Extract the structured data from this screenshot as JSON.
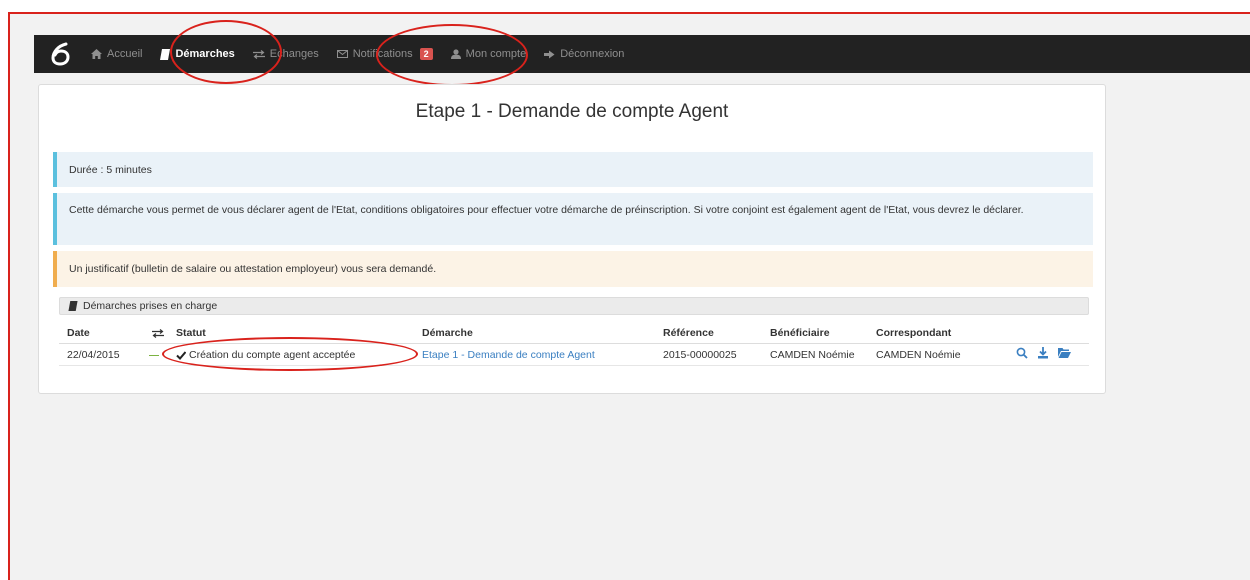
{
  "nav": {
    "items": [
      {
        "label": "Accueil",
        "icon": "home-icon"
      },
      {
        "label": "Démarches",
        "icon": "book-icon"
      },
      {
        "label": "Echanges",
        "icon": "exchange-icon"
      },
      {
        "label": "Notifications",
        "icon": "envelope-icon",
        "badge": "2"
      },
      {
        "label": "Mon compte",
        "icon": "user-icon"
      },
      {
        "label": "Déconnexion",
        "icon": "logout-icon"
      }
    ],
    "active": "Démarches"
  },
  "page": {
    "title": "Etape 1 - Demande de compte Agent"
  },
  "alerts": {
    "duration": "Durée : 5 minutes",
    "description": "Cette démarche vous permet de vous déclarer agent de l'Etat, conditions obligatoires pour effectuer votre démarche de préinscription. Si votre conjoint est également agent de l'Etat, vous devrez le déclarer.",
    "warning": "Un justificatif (bulletin de salaire ou attestation employeur) vous sera demandé."
  },
  "table": {
    "heading": "Démarches prises en charge",
    "columns": {
      "date": "Date",
      "statut": "Statut",
      "demarche": "Démarche",
      "reference": "Référence",
      "beneficiaire": "Bénéficiaire",
      "correspondant": "Correspondant"
    },
    "rows": [
      {
        "date": "22/04/2015",
        "statut": "Création du compte agent acceptée",
        "demarche": "Etape 1 - Demande de compte Agent",
        "reference": "2015-00000025",
        "beneficiaire": "CAMDEN Noémie",
        "correspondant": "CAMDEN Noémie"
      }
    ]
  },
  "colors": {
    "navbar": "#222222",
    "annotation_red": "#d9221c",
    "link": "#3a7fc1",
    "info_border": "#5bc0de",
    "warning_border": "#f0ad4e",
    "badge": "#d9534f"
  }
}
